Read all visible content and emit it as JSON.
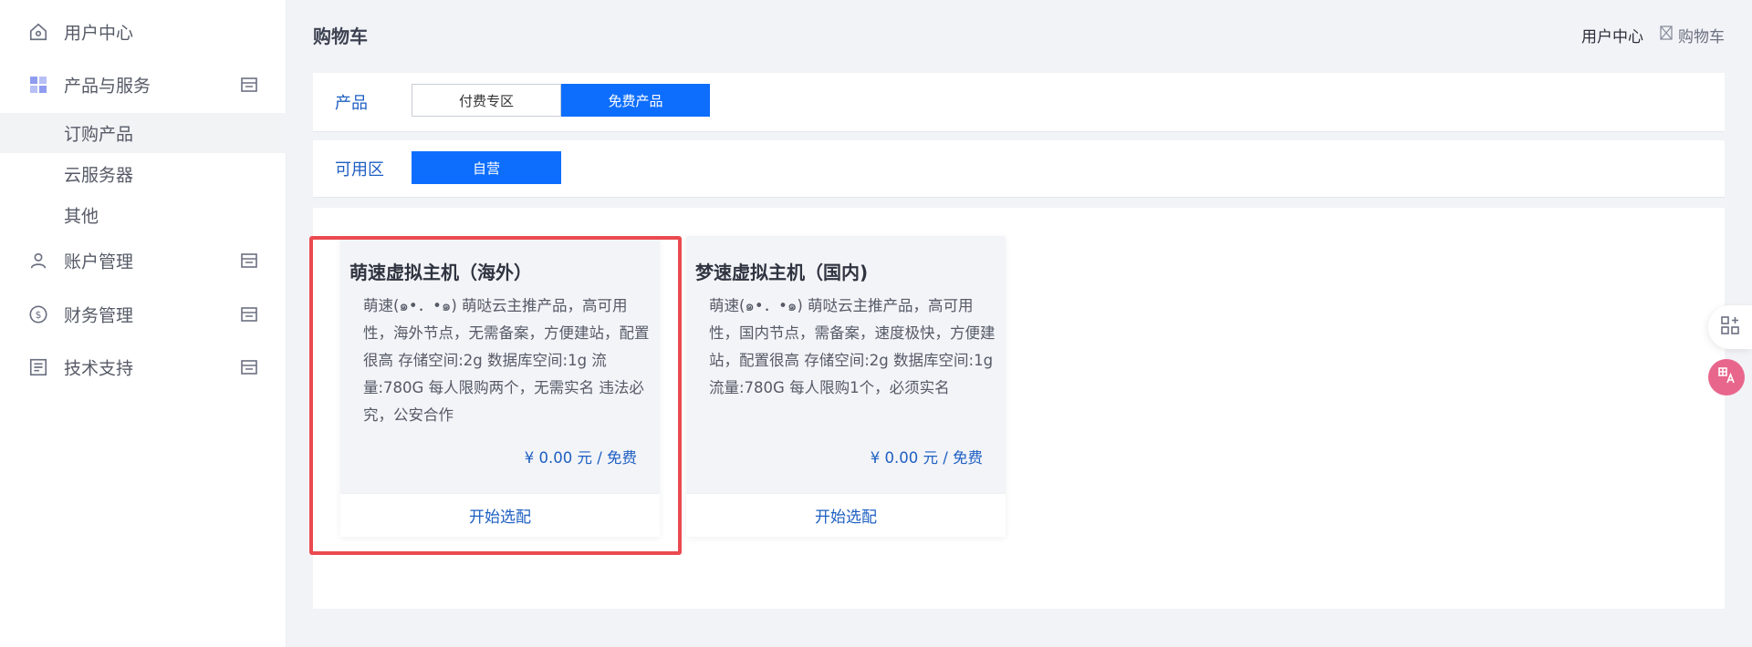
{
  "sidebar": {
    "items": [
      {
        "label": "用户中心",
        "icon": "home-icon"
      },
      {
        "label": "产品与服务",
        "icon": "apps-grid-icon",
        "extra_icon": "store-icon"
      },
      {
        "label": "账户管理",
        "icon": "user-icon",
        "extra_icon": "store-icon"
      },
      {
        "label": "财务管理",
        "icon": "dollar-circle-icon",
        "extra_icon": "store-icon"
      },
      {
        "label": "技术支持",
        "icon": "document-list-icon",
        "extra_icon": "store-icon"
      }
    ],
    "sub_items": [
      {
        "label": "订购产品",
        "active": true
      },
      {
        "label": "云服务器",
        "active": false
      },
      {
        "label": "其他",
        "active": false
      }
    ]
  },
  "header": {
    "title": "购物车",
    "links": [
      {
        "label": "用户中心"
      },
      {
        "label": "购物车",
        "icon": "cart-broken-image-icon"
      }
    ]
  },
  "filters": {
    "product": {
      "label": "产品",
      "options": [
        {
          "label": "付费专区",
          "selected": false
        },
        {
          "label": "免费产品",
          "selected": true
        }
      ]
    },
    "zone": {
      "label": "可用区",
      "options": [
        {
          "label": "自营",
          "selected": true
        }
      ]
    }
  },
  "products": [
    {
      "title": "萌速虚拟主机（海外）",
      "description": "萌速(๑•．•๑) 萌哒云主推产品，高可用性，海外节点，无需备案，方便建站，配置很高 存储空间:2g 数据库空间:1g 流量:780G 每人限购两个，无需实名 违法必究，公安合作",
      "price": "¥ 0.00 元 / 免费",
      "action": "开始选配",
      "highlighted": true
    },
    {
      "title": "梦速虚拟主机（国内)",
      "description": "萌速(๑•．•๑) 萌哒云主推产品，高可用性，国内节点，需备案，速度极快，方便建站，配置很高 存储空间:2g 数据库空间:1g 流量:780G 每人限购1个，必须实名",
      "price": "¥ 0.00 元 / 免费",
      "action": "开始选配",
      "highlighted": false
    }
  ],
  "floating": [
    {
      "icon": "grid-add-icon"
    },
    {
      "icon": "translate-icon"
    }
  ],
  "colors": {
    "accent": "#0d6efd",
    "link": "#1e5fc2",
    "highlight": "#ea4a4f"
  }
}
